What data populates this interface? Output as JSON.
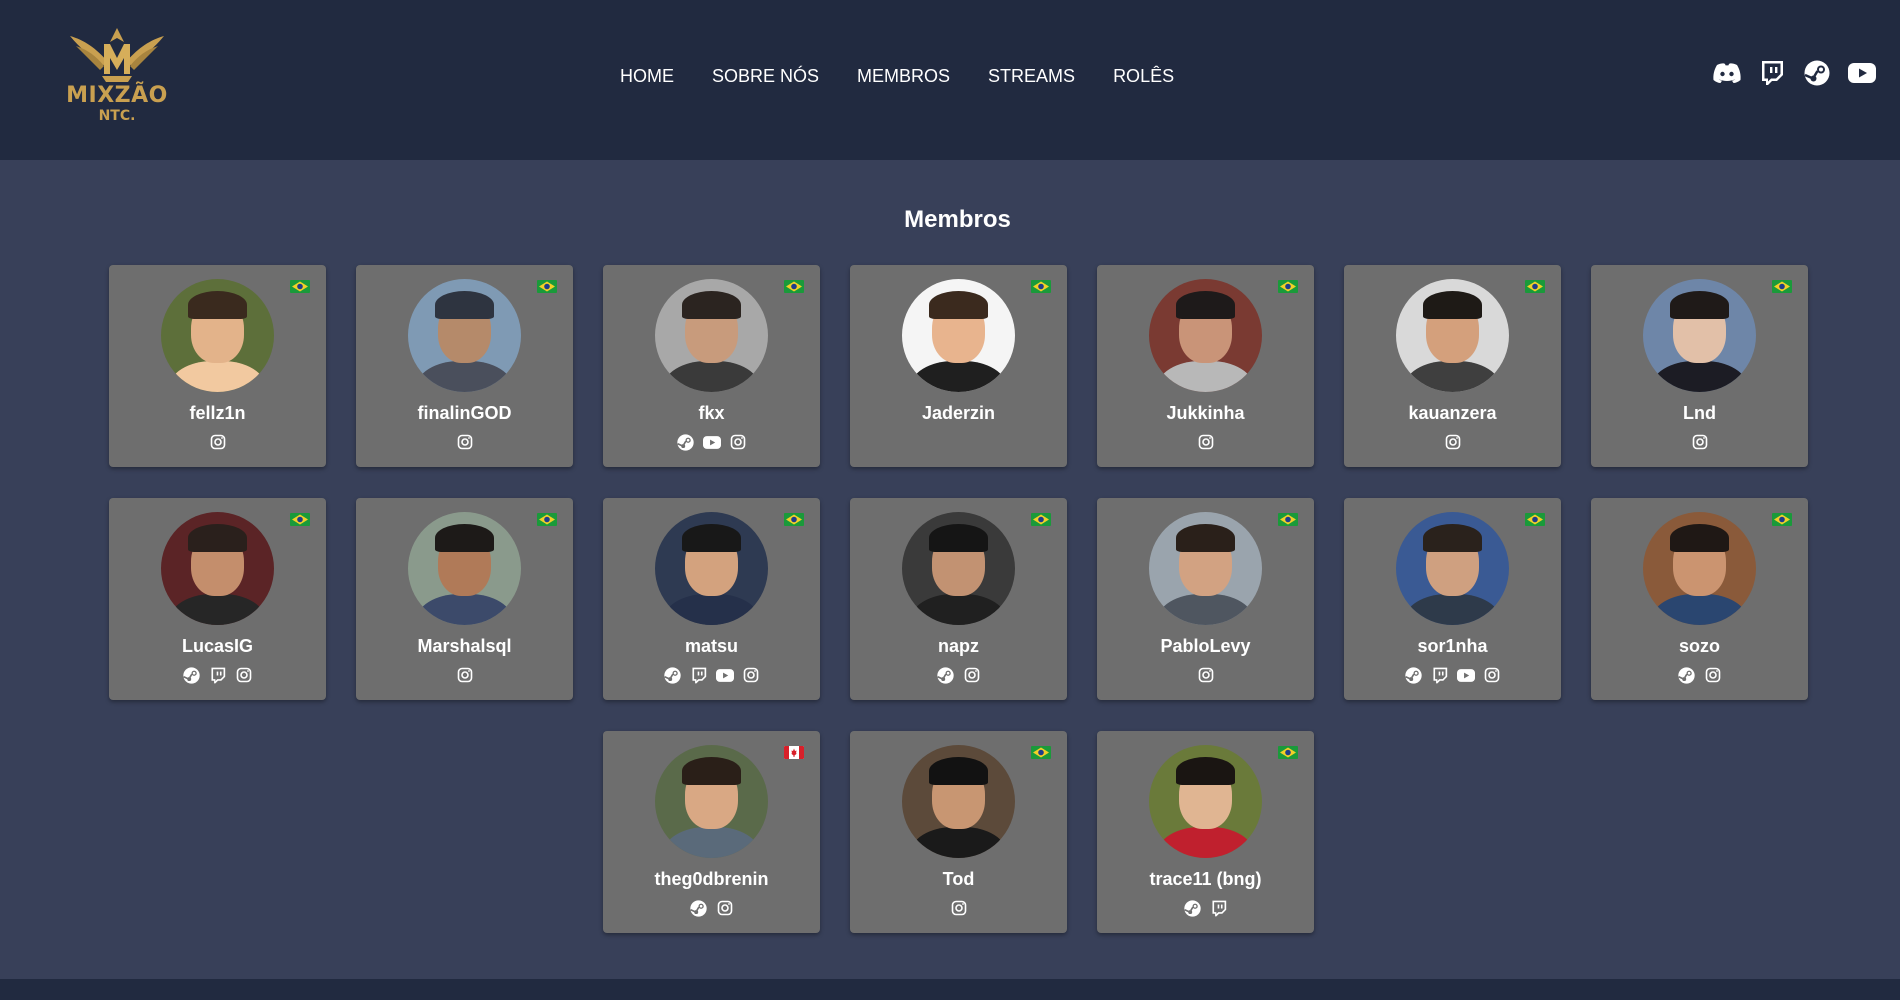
{
  "brand": {
    "name": "MIXZÃO",
    "sub": "NTC.",
    "color": "#c9a050"
  },
  "nav": [
    "HOME",
    "SOBRE NÓS",
    "MEMBROS",
    "STREAMS",
    "ROLÊS"
  ],
  "social": [
    "discord-icon",
    "twitch-icon",
    "steam-icon",
    "youtube-icon"
  ],
  "page_title": "Membros",
  "colors": {
    "header_bg": "#212a40",
    "page_bg": "#384059",
    "card_bg": "#6e6e6e"
  },
  "members": [
    {
      "name": "fellz1n",
      "flag": "br",
      "links": [
        "instagram"
      ]
    },
    {
      "name": "finalinGOD",
      "flag": "br",
      "links": [
        "instagram"
      ]
    },
    {
      "name": "fkx",
      "flag": "br",
      "links": [
        "steam",
        "youtube",
        "instagram"
      ]
    },
    {
      "name": "Jaderzin",
      "flag": "br",
      "links": []
    },
    {
      "name": "Jukkinha",
      "flag": "br",
      "links": [
        "instagram"
      ]
    },
    {
      "name": "kauanzera",
      "flag": "br",
      "links": [
        "instagram"
      ]
    },
    {
      "name": "Lnd",
      "flag": "br",
      "links": [
        "instagram"
      ]
    },
    {
      "name": "LucasIG",
      "flag": "br",
      "links": [
        "steam",
        "twitch",
        "instagram"
      ]
    },
    {
      "name": "Marshalsql",
      "flag": "br",
      "links": [
        "instagram"
      ]
    },
    {
      "name": "matsu",
      "flag": "br",
      "links": [
        "steam",
        "twitch",
        "youtube",
        "instagram"
      ]
    },
    {
      "name": "napz",
      "flag": "br",
      "links": [
        "steam",
        "instagram"
      ]
    },
    {
      "name": "PabloLevy",
      "flag": "br",
      "links": [
        "instagram"
      ]
    },
    {
      "name": "sor1nha",
      "flag": "br",
      "links": [
        "steam",
        "twitch",
        "youtube",
        "instagram"
      ]
    },
    {
      "name": "sozo",
      "flag": "br",
      "links": [
        "steam",
        "instagram"
      ]
    },
    {
      "name": "theg0dbrenin",
      "flag": "ca",
      "links": [
        "steam",
        "instagram"
      ]
    },
    {
      "name": "Tod",
      "flag": "br",
      "links": [
        "instagram"
      ]
    },
    {
      "name": "trace11 (bng)",
      "flag": "br",
      "links": [
        "steam",
        "twitch"
      ]
    }
  ]
}
